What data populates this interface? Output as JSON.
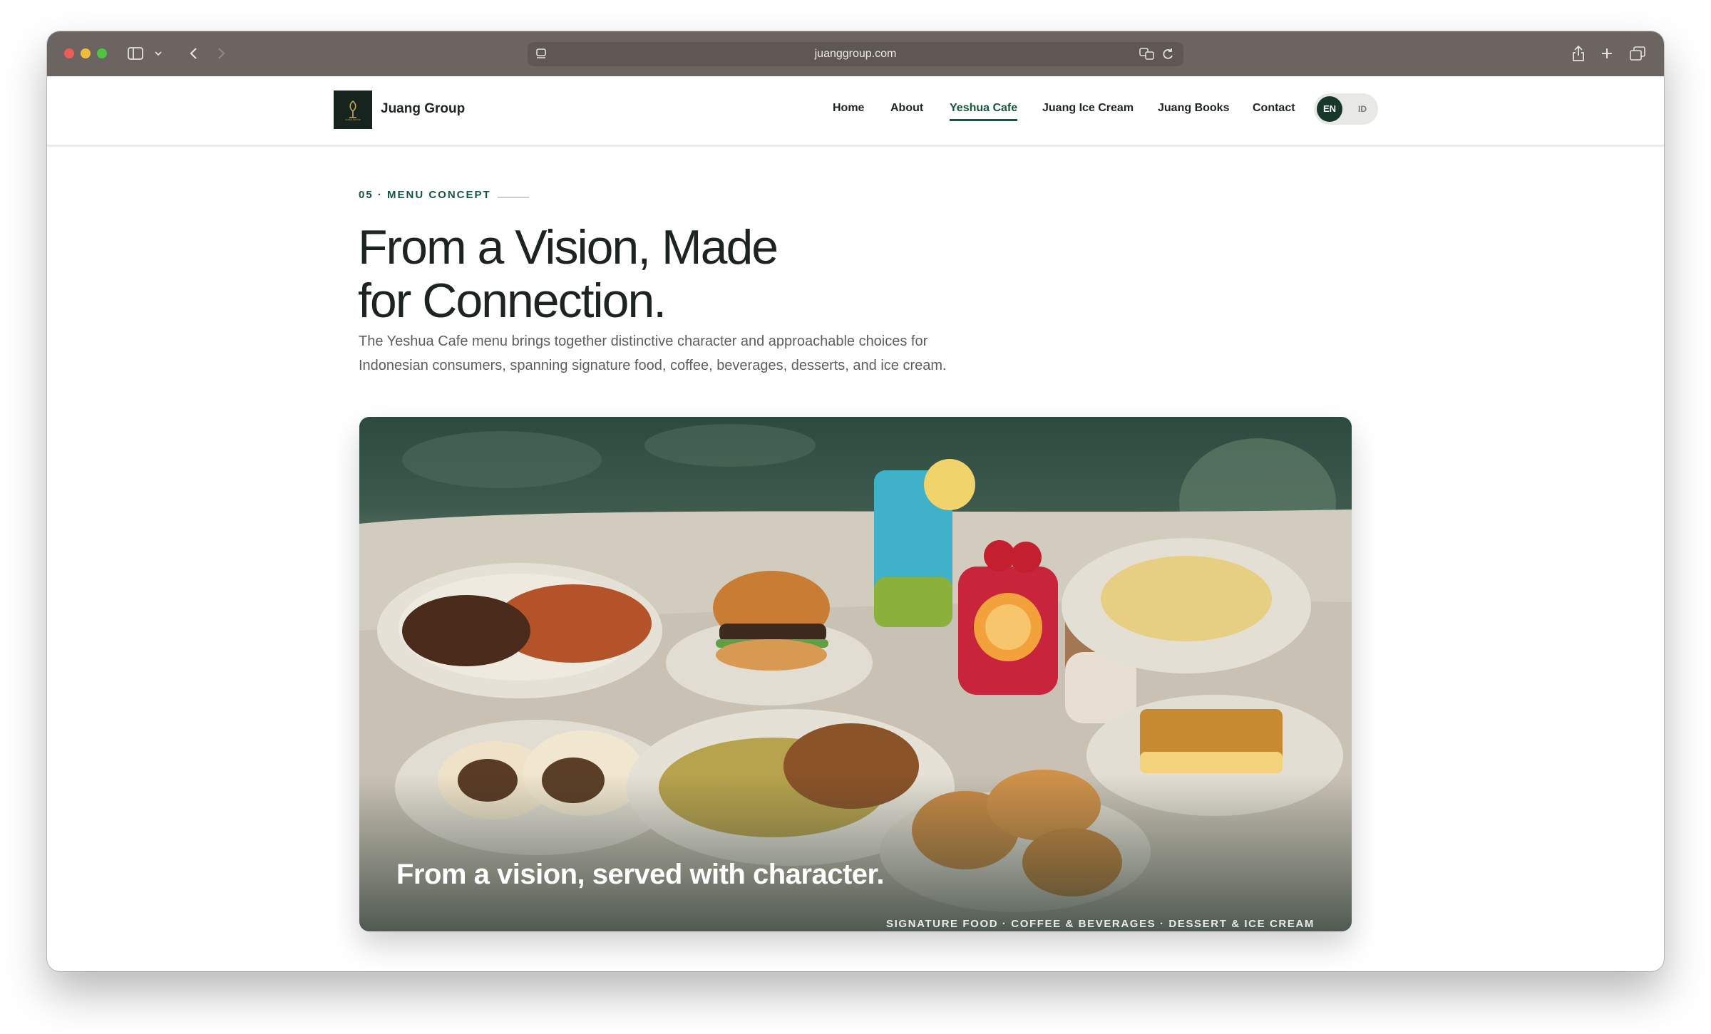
{
  "browser": {
    "url": "juanggroup.com"
  },
  "header": {
    "brand": "Juang Group",
    "nav": [
      "Home",
      "About",
      "Yeshua Cafe",
      "Juang Ice Cream",
      "Juang Books",
      "Contact"
    ],
    "active_nav": "Yeshua Cafe",
    "lang": {
      "active": "EN",
      "inactive": "ID"
    }
  },
  "section": {
    "eyebrow": "05 · MENU CONCEPT",
    "headline_line1": "From a Vision, Made",
    "headline_line2": "for Connection.",
    "lead_line1": "The Yeshua Cafe menu brings together distinctive character and approachable choices for",
    "lead_line2": "Indonesian consumers, spanning signature food, coffee, beverages, desserts, and ice cream."
  },
  "hero": {
    "caption": "From a vision, served with character.",
    "tags": "SIGNATURE FOOD · COFFEE & BEVERAGES · DESSERT & ICE CREAM"
  },
  "colors": {
    "accent_green": "#14573b",
    "chrome": "#6b6460",
    "logo_bg": "#16241d"
  }
}
